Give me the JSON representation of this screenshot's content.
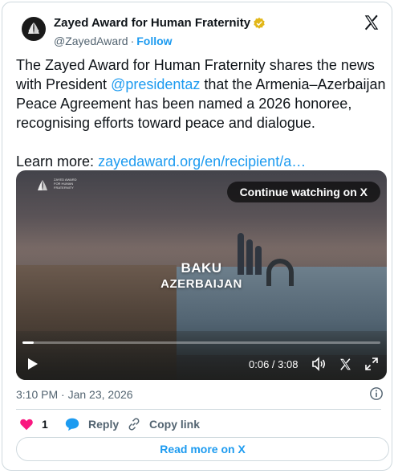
{
  "account": {
    "display_name": "Zayed Award for Human Fraternity",
    "handle": "@ZayedAward",
    "separator": "·",
    "follow_label": "Follow"
  },
  "tweet": {
    "text_part1": "The Zayed Award for Human Fraternity shares the news with President ",
    "mention": "@presidentaz",
    "text_part2": "  that the Armenia–Azerbaijan Peace Agreement has been named a 2026 honoree, recognising efforts toward peace and dialogue.",
    "learn_more_label": "Learn more: ",
    "learn_more_link": "zayedaward.org/en/recipient/a…"
  },
  "video": {
    "continue_label": "Continue watching on X",
    "city_line1": "BAKU",
    "city_line2": "AZERBAIJAN",
    "time_display": "0:06 / 3:08",
    "progress": 0.032,
    "logo_text": "ZAYED AWARD FOR HUMAN FRATERNITY"
  },
  "meta": {
    "timestamp": "3:10 PM · Jan 23, 2026"
  },
  "actions": {
    "like_count": "1",
    "reply_label": "Reply",
    "copy_label": "Copy link",
    "read_more_label": "Read more on X"
  },
  "colors": {
    "accent": "#1d9bf0",
    "like": "#f91880",
    "verified": "#e2b719",
    "text": "#0f1419",
    "muted": "#536471"
  }
}
